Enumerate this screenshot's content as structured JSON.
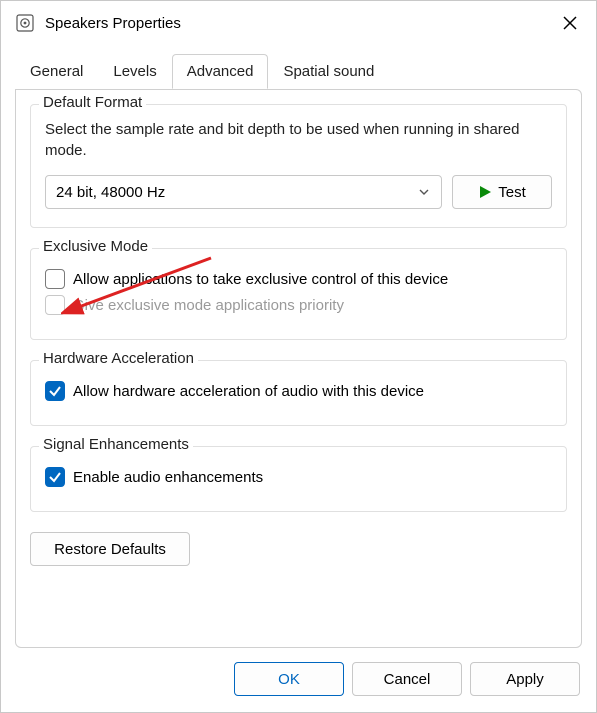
{
  "window": {
    "title": "Speakers Properties"
  },
  "tabs": {
    "general": "General",
    "levels": "Levels",
    "advanced": "Advanced",
    "spatial": "Spatial sound"
  },
  "default_format": {
    "legend": "Default Format",
    "description": "Select the sample rate and bit depth to be used when running in shared mode.",
    "selected": "24 bit, 48000 Hz",
    "test_label": "Test"
  },
  "exclusive_mode": {
    "legend": "Exclusive Mode",
    "opt1": "Allow applications to take exclusive control of this device",
    "opt2": "Give exclusive mode applications priority"
  },
  "hardware_accel": {
    "legend": "Hardware Acceleration",
    "opt1": "Allow hardware acceleration of audio with this device"
  },
  "signal_enh": {
    "legend": "Signal Enhancements",
    "opt1": "Enable audio enhancements"
  },
  "restore_defaults": "Restore Defaults",
  "footer": {
    "ok": "OK",
    "cancel": "Cancel",
    "apply": "Apply"
  }
}
